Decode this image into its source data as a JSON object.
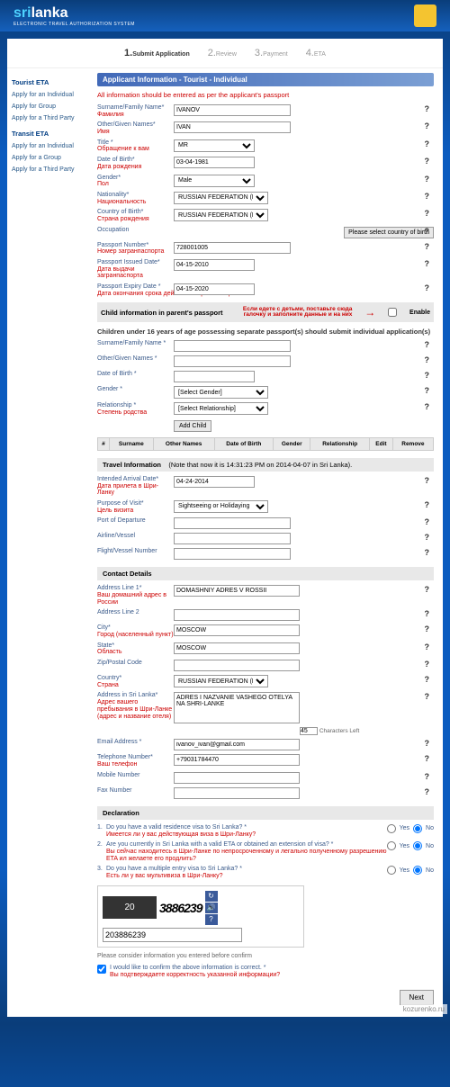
{
  "logo": {
    "part1": "sri",
    "part2": "lanka",
    "sub": "ELECTRONIC TRAVEL AUTHORIZATION SYSTEM"
  },
  "steps": {
    "s1": "Submit Application",
    "s2": "Review",
    "s3": "Payment",
    "s4": "ETA"
  },
  "sidebar": {
    "h1": "Tourist ETA",
    "a1": "Apply for an Individual",
    "a2": "Apply for Group",
    "a3": "Apply for a Third Party",
    "h2": "Transit ETA",
    "a4": "Apply for an Individual",
    "a5": "Apply for a Group",
    "a6": "Apply for a Third Party"
  },
  "secApplicant": "Applicant Information - Tourist - Individual",
  "instruction": "All information should be entered as per the applicant's passport",
  "labels": {
    "surname": "Surname/Family Name*",
    "surname_ru": "Фамилия",
    "given": "Other/Given Names*",
    "given_ru": "Имя",
    "title": "Title *",
    "title_ru": "Обращение к вам",
    "dob": "Date of Birth*",
    "dob_ru": "Дата рождения",
    "gender": "Gender*",
    "gender_ru": "Пол",
    "nat": "Nationality*",
    "nat_ru": "Национальность",
    "cob": "Country of Birth*",
    "cob_ru": "Страна рождения",
    "occ": "Occupation",
    "ppn": "Passport Number*",
    "ppn_ru": "Номер загранпаспорта",
    "pid": "Passport Issued Date*",
    "pid_ru": "Дата выдачи загранпаспорта",
    "ped": "Passport Expiry Date *",
    "ped_ru": "Дата окончания срока действия загранпаспорта",
    "csurname": "Surname/Family Name *",
    "cgiven": "Other/Given Names *",
    "cdob": "Date of Birth *",
    "cgender": "Gender *",
    "crel": "Relationship *",
    "crel_ru": "Степень родства",
    "iad": "Intended Arrival Date*",
    "iad_ru": "Дата прилета в Шри-Ланку",
    "pov": "Purpose of Visit*",
    "pov_ru": "Цель визита",
    "pod": "Port of Departure",
    "air": "Airline/Vessel",
    "fvn": "Flight/Vessel Number",
    "al1": "Address Line 1*",
    "al1_ru": "Ваш домашний адрес в России",
    "al2": "Address Line 2",
    "city": "City*",
    "city_ru": "Город (населенный пункт)",
    "state": "State*",
    "state_ru": "Область",
    "zip": "Zip/Postal Code",
    "country": "Country*",
    "country_ru": "Страна",
    "asl": "Address in Sri Lanka*",
    "asl_ru": "Адрес вашего пребывания в Шри-Ланке (адрес и название отеля)",
    "email": "Email Address *",
    "tel": "Telephone Number*",
    "tel_ru": "Ваш телефон",
    "mob": "Mobile Number",
    "fax": "Fax Number"
  },
  "values": {
    "surname": "IVANOV",
    "given": "IVAN",
    "title": "MR",
    "dob": "03-04-1981",
    "gender": "Male",
    "nat": "RUSSIAN FEDERATION (Р",
    "cob": "RUSSIAN FEDERATION (Р",
    "ppn": "728001005",
    "pid": "04-15-2010",
    "ped": "04-15-2020",
    "cgender": "[Select Gender]",
    "crel": "[Select Relationship]",
    "iad": "04-24-2014",
    "pov": "Sightseeing or Holidaying",
    "al1": "DOMASHNIY ADRES V ROSSII",
    "city": "MOSCOW",
    "state": "MOSCOW",
    "country": "RUSSIAN FEDERATION (Р",
    "asl": "ADRES I NAZVANIE VASHEGO OTELYA NA SHRI-LANKE",
    "email": "ivanov_ivan@gmail.com",
    "tel": "+79031784470",
    "captcha": "203886239"
  },
  "btns": {
    "selcob": "Please select country of birth",
    "addchild": "Add Child",
    "next": "Next"
  },
  "childHead": "Child information in parent's passport",
  "childNote": "Если едете с детьми, поставьте сюда галочку и заполните данные и на них",
  "enable": "Enable",
  "childHint": "Children under 16 years of age possessing separate passport(s) should submit individual application(s)",
  "tblH": {
    "num": "#",
    "surname": "Surname",
    "other": "Other Names",
    "dob": "Date of Birth",
    "gender": "Gender",
    "rel": "Relationship",
    "edit": "Edit",
    "rem": "Remove"
  },
  "travelHead": "Travel Information",
  "travelNote": "(Note that now it is 14:31:23 PM on 2014-04-07 in Sri Lanka).",
  "contactHead": "Contact Details",
  "charLeft": "Characters Left",
  "charNum": "45",
  "declHead": "Declaration",
  "decl1": "Do you have a valid residence visa to Sri Lanka? *",
  "decl1ru": "Имеется ли у вас действующая виза в Шри-Ланку?",
  "decl2": "Are you currently in Sri Lanka with a valid ETA or obtained an extension of visa? *",
  "decl2ru": "Вы сейчас находитесь в Шри-Ланке по непросроченному и легально полученному разрешению ETA ил желаете его продлить?",
  "decl3": "Do you have a multiple entry visa to Sri Lanka? *",
  "decl3ru": "Есть ли у вас мультивиза в Шри-Ланку?",
  "yes": "Yes",
  "no": "No",
  "captchaDisplay": "3886239",
  "captchaBox": "20",
  "consider": "Please consider information you entered before confirm",
  "confirm": "I would like to confirm the above information is correct. *",
  "confirmru": "Вы подтверждаете корректность указанной информации?",
  "watermark": "kozurenko.ru"
}
